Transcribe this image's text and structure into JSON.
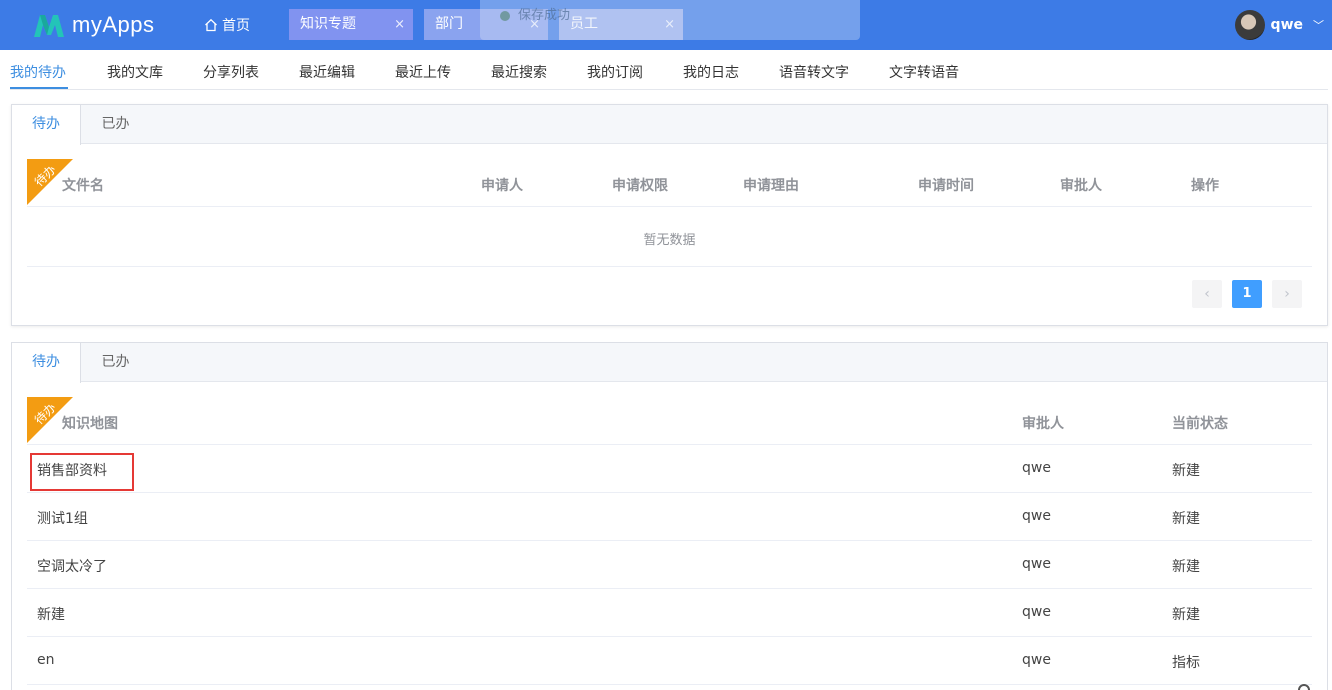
{
  "app": {
    "name": "myApps"
  },
  "header": {
    "home_label": "首页",
    "tabs": [
      {
        "label": "知识专题",
        "close": "×"
      },
      {
        "label": "部门",
        "close": "×"
      },
      {
        "label": "员工",
        "close": "×"
      }
    ],
    "toast": "保存成功",
    "user_name": "qwe",
    "user_chevron": "﹀"
  },
  "nav": {
    "items": [
      "我的待办",
      "我的文库",
      "分享列表",
      "最近编辑",
      "最近上传",
      "最近搜索",
      "我的订阅",
      "我的日志",
      "语音转文字",
      "文字转语音"
    ]
  },
  "panel1": {
    "tabs": [
      "待办",
      "已办"
    ],
    "badge": "待办",
    "columns": [
      "文件名",
      "申请人",
      "申请权限",
      "申请理由",
      "申请时间",
      "审批人",
      "操作"
    ],
    "empty_text": "暂无数据",
    "pager": {
      "prev": "‹",
      "current": "1",
      "next": "›"
    }
  },
  "panel2": {
    "tabs": [
      "待办",
      "已办"
    ],
    "badge": "待办",
    "columns": [
      "知识地图",
      "审批人",
      "当前状态"
    ],
    "rows": [
      {
        "name": "销售部资料",
        "approver": "qwe",
        "status": "新建"
      },
      {
        "name": "测试1组",
        "approver": "qwe",
        "status": "新建"
      },
      {
        "name": "空调太冷了",
        "approver": "qwe",
        "status": "新建"
      },
      {
        "name": "新建",
        "approver": "qwe",
        "status": "新建"
      },
      {
        "name": "en",
        "approver": "qwe",
        "status": "指标"
      }
    ]
  },
  "colors": {
    "header": "#3d7be6",
    "accent": "#3d8ee0",
    "badge": "#f39c12",
    "highlight": "#e53935",
    "pager_active": "#409eff"
  }
}
